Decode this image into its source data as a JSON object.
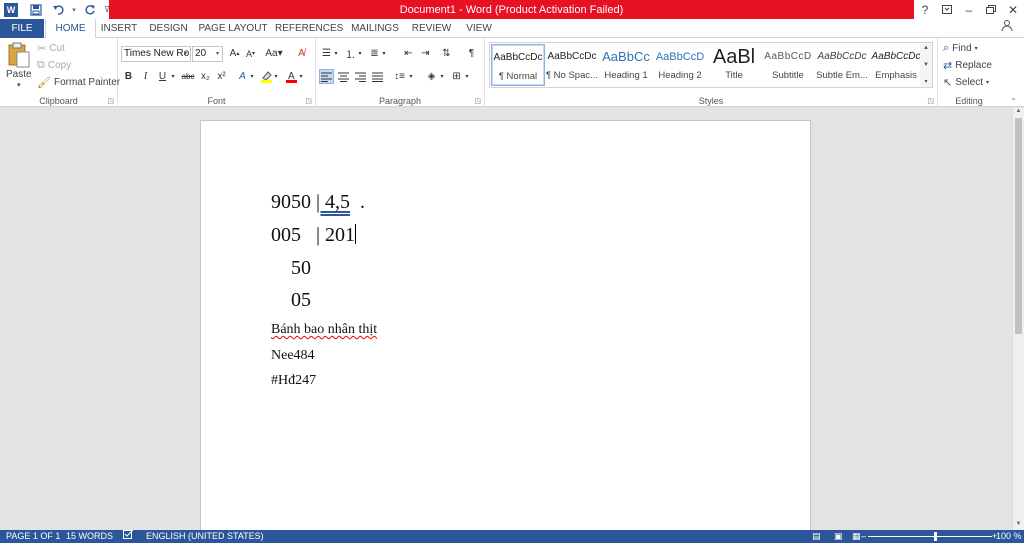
{
  "window": {
    "title": "Document1 - Word (Product Activation Failed)",
    "controls": [
      "?",
      "❐",
      "–",
      "❐",
      "✕"
    ]
  },
  "qat": {
    "app_icon": "W",
    "save": "💾",
    "undo": "↶",
    "redo": "↻",
    "customize": "▾"
  },
  "tabs": [
    "FILE",
    "HOME",
    "INSERT",
    "DESIGN",
    "PAGE LAYOUT",
    "REFERENCES",
    "MAILINGS",
    "REVIEW",
    "VIEW"
  ],
  "active_tab": "HOME",
  "ribbon": {
    "clipboard": {
      "label": "Clipboard",
      "paste": "Paste",
      "cut": "Cut",
      "copy": "Copy",
      "format_painter": "Format Painter"
    },
    "font": {
      "label": "Font",
      "font_name": "Times New Ro",
      "font_size": "20",
      "bold": "B",
      "italic": "I",
      "underline": "U",
      "strike": "abc",
      "sub": "x₂",
      "sup": "x²",
      "grow": "A",
      "shrink": "A",
      "case": "Aa"
    },
    "paragraph": {
      "label": "Paragraph"
    },
    "styles": {
      "label": "Styles",
      "items": [
        {
          "preview": "AaBbCcDc",
          "name": "¶ Normal"
        },
        {
          "preview": "AaBbCcDc",
          "name": "¶ No Spac..."
        },
        {
          "preview": "AaBbCc",
          "name": "Heading 1"
        },
        {
          "preview": "AaBbCcD",
          "name": "Heading 2"
        },
        {
          "preview": "AaBl",
          "name": "Title"
        },
        {
          "preview": "AaBbCcD",
          "name": "Subtitle"
        },
        {
          "preview": "AaBbCcDc",
          "name": "Subtle Em..."
        },
        {
          "preview": "AaBbCcDc",
          "name": "Emphasis"
        }
      ]
    },
    "editing": {
      "label": "Editing",
      "find": "Find",
      "replace": "Replace",
      "select": "Select"
    }
  },
  "document": {
    "lines": [
      {
        "a": "9050 ",
        "b": "| 4,5",
        "c": "  ."
      },
      {
        "a": "005   | 201"
      },
      {
        "a": "    50"
      },
      {
        "a": "    05"
      },
      {
        "a": "Bánh bao nhân thịt"
      },
      {
        "a": "Nee484"
      },
      {
        "a": "#Hđ247"
      }
    ]
  },
  "status": {
    "page": "PAGE 1 OF 1",
    "words": "15 WORDS",
    "language": "ENGLISH (UNITED STATES)",
    "zoom": "100 %",
    "zoom_minus": "–",
    "zoom_plus": "+"
  },
  "colors": {
    "brand": "#2b579a",
    "title_red": "#e81123",
    "highlight": "#ffff00",
    "font_color": "#ff0000"
  }
}
